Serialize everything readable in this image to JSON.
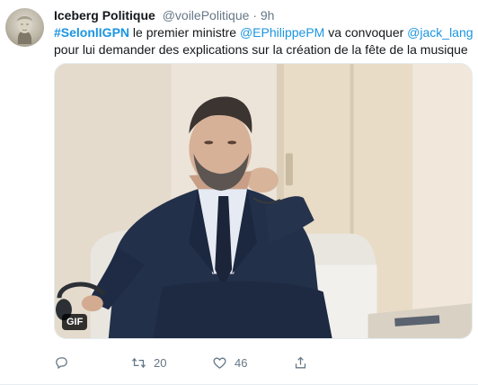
{
  "tweet": {
    "author_name": "Iceberg Politique",
    "author_handle": "@voilePolitique",
    "separator": "·",
    "time": "9h",
    "text": {
      "hashtag": "#SelonlIGPN",
      "part1": " le premier ministre ",
      "mention1": "@EPhilippePM",
      "part2": " va convoquer ",
      "mention2": "@jack_lang",
      "line2": "pour lui demander des explications sur la création de la fête de la musique"
    },
    "media": {
      "badge": "GIF"
    },
    "actions": {
      "reply_icon": "reply-icon",
      "retweet_count": "20",
      "like_count": "46",
      "share_icon": "share-icon"
    }
  },
  "colors": {
    "link": "#1b95e0",
    "muted": "#657786",
    "text": "#14171a"
  }
}
